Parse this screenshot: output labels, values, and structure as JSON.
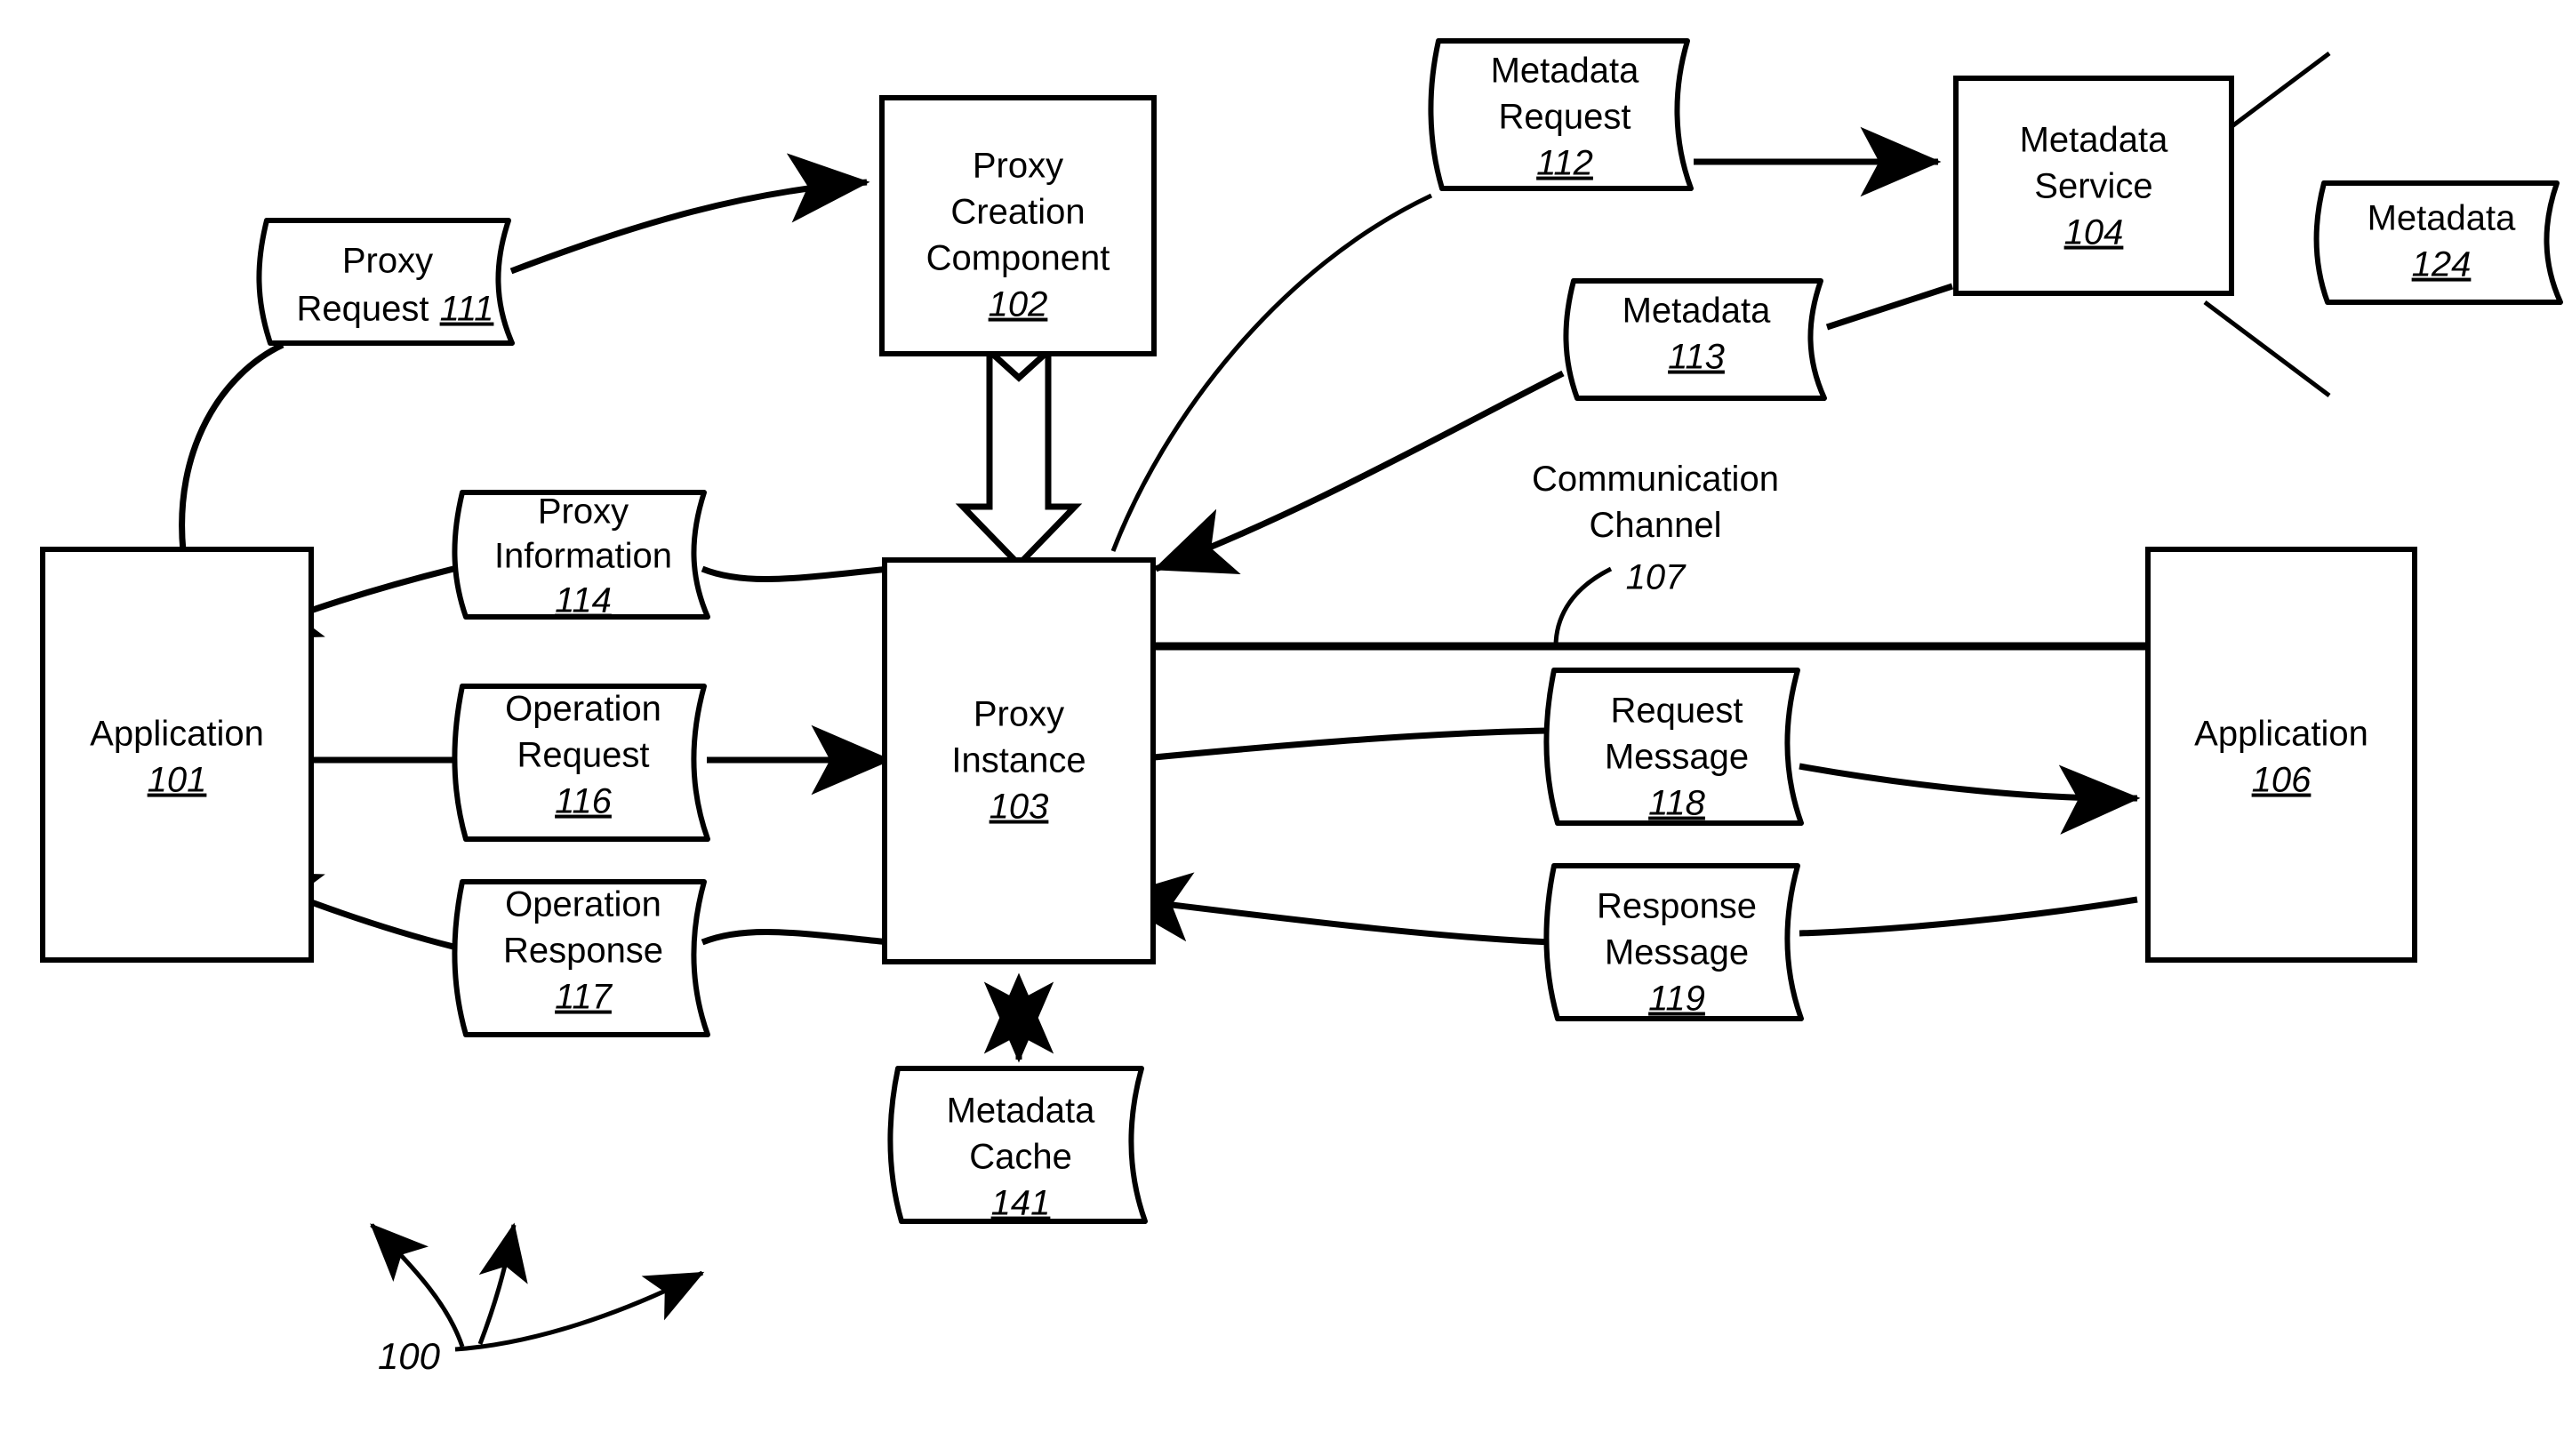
{
  "figure": {
    "reference_numeral": "100",
    "nodes": {
      "application_101": {
        "line1": "Application",
        "ref": "101"
      },
      "proxy_creation_component_102": {
        "line1": "Proxy",
        "line2": "Creation",
        "line3": "Component",
        "ref": "102"
      },
      "proxy_instance_103": {
        "line1": "Proxy",
        "line2": "Instance",
        "ref": "103"
      },
      "metadata_service_104": {
        "line1": "Metadata",
        "line2": "Service",
        "ref": "104"
      },
      "application_106": {
        "line1": "Application",
        "ref": "106"
      }
    },
    "documents": {
      "proxy_request_111": {
        "line1": "Proxy",
        "line2": "Request",
        "ref": "111",
        "ref_inline": true
      },
      "metadata_request_112": {
        "line1": "Metadata",
        "line2": "Request",
        "ref": "112"
      },
      "metadata_113": {
        "line1": "Metadata",
        "ref": "113"
      },
      "proxy_information_114": {
        "line1": "Proxy",
        "line2": "Information",
        "ref": "114"
      },
      "operation_request_116": {
        "line1": "Operation",
        "line2": "Request",
        "ref": "116"
      },
      "operation_response_117": {
        "line1": "Operation",
        "line2": "Response",
        "ref": "117"
      },
      "request_message_118": {
        "line1": "Request",
        "line2": "Message",
        "ref": "118"
      },
      "response_message_119": {
        "line1": "Response",
        "line2": "Message",
        "ref": "119"
      },
      "metadata_124": {
        "line1": "Metadata",
        "ref": "124"
      },
      "metadata_cache_141": {
        "line1": "Metadata",
        "line2": "Cache",
        "ref": "141"
      }
    },
    "annotations": {
      "communication_channel": {
        "line1": "Communication",
        "line2": "Channel",
        "ref": "107"
      }
    },
    "colors": {
      "ink": "#000000",
      "paper": "#ffffff"
    }
  }
}
